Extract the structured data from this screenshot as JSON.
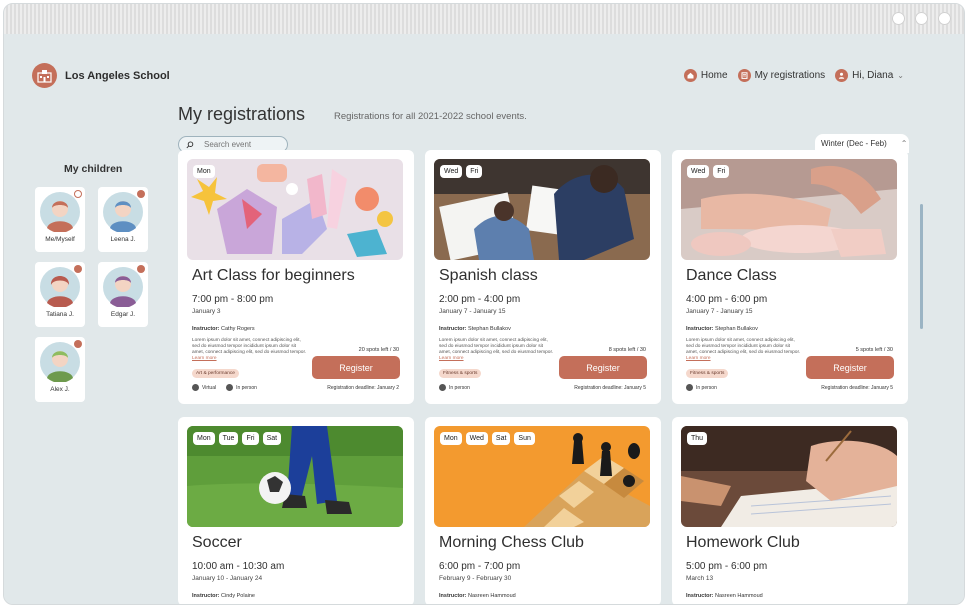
{
  "brand": {
    "name": "Los Angeles School"
  },
  "nav": {
    "home": "Home",
    "registrations": "My registrations",
    "user": "Hi, Diana"
  },
  "page": {
    "title": "My registrations",
    "subtitle": "Registrations for all 2021-2022 school events."
  },
  "search": {
    "placeholder": "Search event"
  },
  "season": {
    "value": "Winter (Dec - Feb)"
  },
  "children": {
    "title": "My children",
    "items": [
      {
        "name": "Me/Myself"
      },
      {
        "name": "Leena J."
      },
      {
        "name": "Tatiana J."
      },
      {
        "name": "Edgar J."
      },
      {
        "name": "Alex J."
      }
    ]
  },
  "cards": [
    {
      "tags": [
        "Mon"
      ],
      "title": "Art Class for beginners",
      "time": "7:00 pm - 8:00 pm",
      "date": "January 3",
      "instructor_label": "Instructor:",
      "instructor": "Cathy Rogers",
      "description": "Lorem ipsum dolor sit amet, connect adipiscing elit, sed do eiusmod tempor incididunt ipsum dolor sit amet, connect adipiscing elit, sed do eiusmod tempor.",
      "learn_more": "Learn more",
      "spots": "20 spots left / 30",
      "register": "Register",
      "category": "Art & performance",
      "modes": [
        "Virtual",
        "In person"
      ],
      "deadline": "Registration deadline: January 2"
    },
    {
      "tags": [
        "Wed",
        "Fri"
      ],
      "title": "Spanish class",
      "time": "2:00 pm - 4:00 pm",
      "date": "January 7 - January 15",
      "instructor_label": "Instructor:",
      "instructor": "Stephan Bullakov",
      "description": "Lorem ipsum dolor sit amet, connect adipiscing elit, sed do eiusmod tempor incididunt ipsum dolor sit amet, connect adipiscing elit, sed do eiusmod tempor.",
      "learn_more": "Learn more",
      "spots": "8 spots left / 30",
      "register": "Register",
      "category": "Fitness & sports",
      "modes": [
        "In person"
      ],
      "deadline": "Registration deadline: January 5"
    },
    {
      "tags": [
        "Wed",
        "Fri"
      ],
      "title": "Dance Class",
      "time": "4:00 pm - 6:00 pm",
      "date": "January 7 - January 15",
      "instructor_label": "Instructor:",
      "instructor": "Stephan Bullakov",
      "description": "Lorem ipsum dolor sit amet, connect adipiscing elit, sed do eiusmod tempor incididunt ipsum dolor sit amet, connect adipiscing elit, sed do eiusmod tempor.",
      "learn_more": "Learn more",
      "spots": "5 spots left / 30",
      "register": "Register",
      "category": "Fitness & sports",
      "modes": [
        "In person"
      ],
      "deadline": "Registration deadline: January 5"
    },
    {
      "tags": [
        "Mon",
        "Tue",
        "Fri",
        "Sat"
      ],
      "title": "Soccer",
      "time": "10:00 am - 10:30 am",
      "date": "January 10 - January 24",
      "instructor_label": "Instructor:",
      "instructor": "Cindy Polaine"
    },
    {
      "tags": [
        "Mon",
        "Wed",
        "Sat",
        "Sun"
      ],
      "title": "Morning Chess Club",
      "time": "6:00 pm - 7:00 pm",
      "date": "February 9 - February 30",
      "instructor_label": "Instructor:",
      "instructor": "Nasreen Hammoud"
    },
    {
      "tags": [
        "Thu"
      ],
      "title": "Homework Club",
      "time": "5:00 pm - 6:00 pm",
      "date": "March 13",
      "instructor_label": "Instructor:",
      "instructor": "Nasreen Hammoud"
    }
  ],
  "colors": {
    "accent": "#c46f5a",
    "background": "#e1e8ea",
    "card": "#ffffff"
  }
}
